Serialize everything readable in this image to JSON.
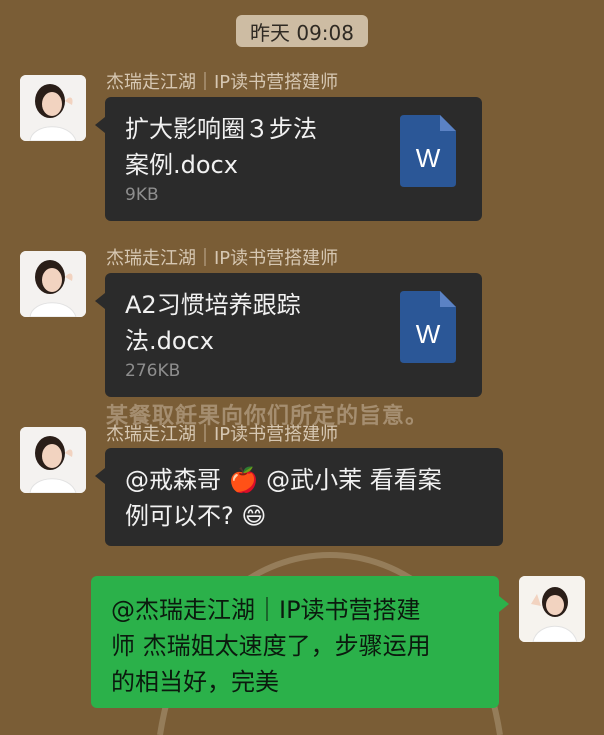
{
  "timestamp": "昨天 09:08",
  "background_text": "某餐取飪果向你们所定的旨意。",
  "messages": [
    {
      "sender": "杰瑞走江湖｜IP读书营搭建师",
      "file": {
        "name_line1": "扩大影响圈３步法",
        "name_line2": "案例.docx",
        "size": "9KB",
        "icon_letter": "W"
      }
    },
    {
      "sender": "杰瑞走江湖｜IP读书营搭建师",
      "file": {
        "name_line1": "A2习惯培养跟踪",
        "name_line2": "法.docx",
        "size": "276KB",
        "icon_letter": "W"
      }
    },
    {
      "sender": "杰瑞走江湖｜IP读书营搭建师",
      "text": {
        "part1": "@戒森哥",
        "part2": "@武小茉 看看案",
        "line2": "例可以不?"
      },
      "emoji_apple": "🍎",
      "emoji_grin": "😄"
    },
    {
      "self": true,
      "text": {
        "line1": "@杰瑞走江湖｜IP读书营搭建",
        "line2": "师 杰瑞姐太速度了，步骤运用",
        "line3": "的相当好，完美"
      }
    }
  ],
  "colors": {
    "background": "#7a5d36",
    "dark_bubble": "#2b2b2b",
    "green_bubble": "#2bb14a",
    "word_blue": "#2b5797"
  }
}
